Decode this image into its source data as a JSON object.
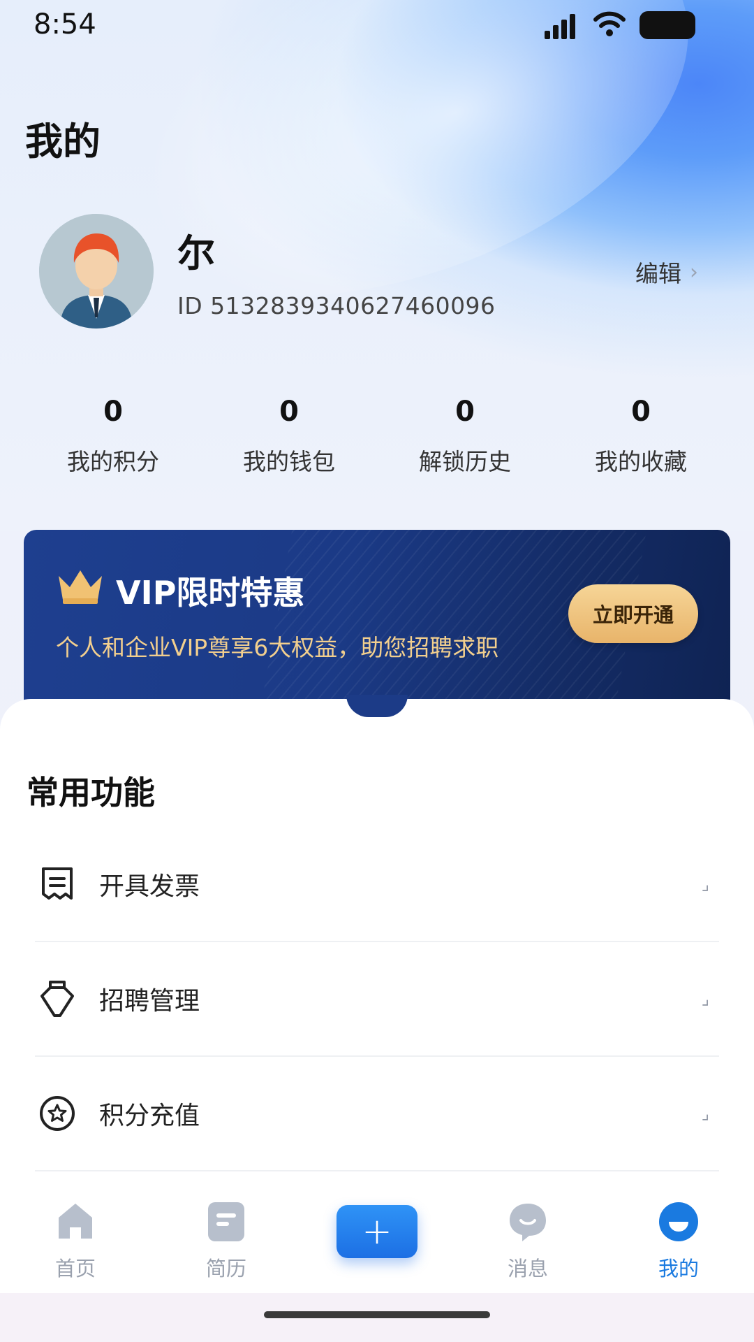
{
  "status_bar": {
    "time": "8:54"
  },
  "header": {
    "title": "我的"
  },
  "profile": {
    "name": "尔",
    "id_text": "ID 5132839340627460096",
    "edit_label": "编辑",
    "edit_chevron": "›"
  },
  "stats": [
    {
      "value": "0",
      "label": "我的积分"
    },
    {
      "value": "0",
      "label": "我的钱包"
    },
    {
      "value": "0",
      "label": "解锁历史"
    },
    {
      "value": "0",
      "label": "我的收藏"
    }
  ],
  "vip": {
    "title": "VIP限时特惠",
    "subtitle": "个人和企业VIP尊享6大权益，助您招聘求职",
    "button_label": "立即开通",
    "accent": "#f2cf8e",
    "card_color": "#1e3f8f"
  },
  "section": {
    "title": "常用功能"
  },
  "menu": [
    {
      "label": "开具发票",
      "icon": "receipt-icon",
      "arrow": "⌟"
    },
    {
      "label": "招聘管理",
      "icon": "briefcase-tie-icon",
      "arrow": "⌟"
    },
    {
      "label": "积分充值",
      "icon": "points-coin-icon",
      "arrow": "⌟"
    }
  ],
  "nav": {
    "items": [
      {
        "label": "首页",
        "icon": "home-icon"
      },
      {
        "label": "简历",
        "icon": "resume-icon"
      },
      {
        "label": "+",
        "icon": "plus-icon"
      },
      {
        "label": "消息",
        "icon": "message-icon"
      },
      {
        "label": "我的",
        "icon": "profile-icon"
      }
    ],
    "active_color": "#1a7ae0",
    "inactive_color": "#9aa1ae"
  }
}
